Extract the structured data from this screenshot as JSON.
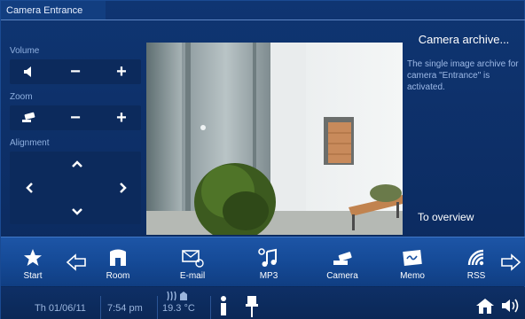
{
  "window": {
    "title": "Camera Entrance"
  },
  "controls": {
    "volume": {
      "label": "Volume",
      "minus": "−",
      "plus": "+"
    },
    "zoom": {
      "label": "Zoom",
      "minus": "−",
      "plus": "+"
    },
    "alignment": {
      "label": "Alignment",
      "up": "⌃",
      "down": "⌄",
      "left": "‹",
      "right": "›"
    }
  },
  "archive": {
    "link": "Camera archive...",
    "message": "The single image archive for camera \"Entrance\" is activated."
  },
  "overview_link": "To overview",
  "dock": {
    "items": [
      {
        "label": "Start",
        "icon": "star-icon"
      },
      {
        "label": "Room",
        "icon": "room-icon"
      },
      {
        "label": "E-mail",
        "icon": "email-icon"
      },
      {
        "label": "MP3",
        "icon": "music-note-icon"
      },
      {
        "label": "Camera",
        "icon": "camera-icon"
      },
      {
        "label": "Memo",
        "icon": "memo-icon"
      },
      {
        "label": "RSS",
        "icon": "rss-icon"
      }
    ]
  },
  "status": {
    "date": "Th 01/06/11",
    "time": "7:54 pm",
    "temperature": "19.3 °C"
  },
  "colors": {
    "background": "#0d2d63",
    "dock": "#1a52a2",
    "accent_text": "#9db9e6"
  }
}
